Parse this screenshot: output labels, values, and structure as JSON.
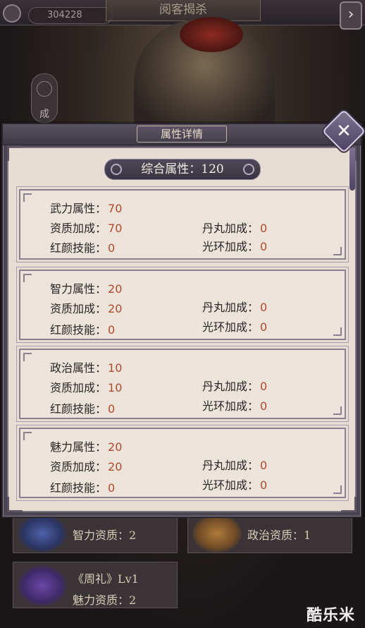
{
  "background": {
    "coins": "304228",
    "title": "阅客揭杀",
    "next_arrow": "›",
    "side_badge": "成",
    "cards": {
      "zhili": "智力资质：2",
      "zhengzhi": "政治资质：1",
      "zhouli_book": "《周礼》Lv1",
      "zhouli_stat": "魅力资质：2"
    },
    "watermark": "酷乐米"
  },
  "modal": {
    "title": "属性详情",
    "close_symbol": "✕",
    "total_label": "综合属性：",
    "total_value": "120"
  },
  "labels": {
    "zizhi": "资质加成：",
    "danwan": "丹丸加成：",
    "hongyan": "红颜技能：",
    "guanghuan": "光环加成："
  },
  "attributes": [
    {
      "name": "武力属性：",
      "value": "70",
      "zizhi": "70",
      "danwan": "0",
      "hongyan": "0",
      "guanghuan": "0"
    },
    {
      "name": "智力属性：",
      "value": "20",
      "zizhi": "20",
      "danwan": "0",
      "hongyan": "0",
      "guanghuan": "0"
    },
    {
      "name": "政治属性：",
      "value": "10",
      "zizhi": "10",
      "danwan": "0",
      "hongyan": "0",
      "guanghuan": "0"
    },
    {
      "name": "魅力属性：",
      "value": "20",
      "zizhi": "20",
      "danwan": "0",
      "hongyan": "0",
      "guanghuan": "0"
    }
  ]
}
